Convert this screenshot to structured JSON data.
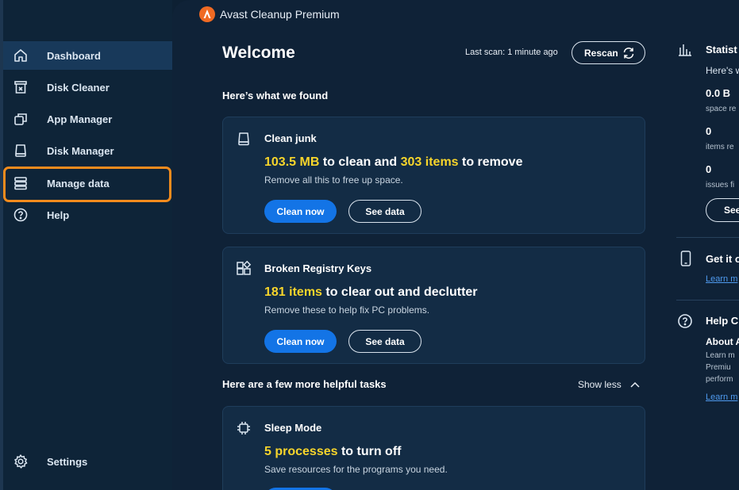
{
  "app": {
    "title": "Avast Cleanup Premium"
  },
  "sidebar": {
    "items": [
      {
        "label": "Dashboard",
        "icon": "home-icon"
      },
      {
        "label": "Disk Cleaner",
        "icon": "trash-icon"
      },
      {
        "label": "App Manager",
        "icon": "windows-icon"
      },
      {
        "label": "Disk Manager",
        "icon": "drive-icon"
      },
      {
        "label": "Manage data",
        "icon": "database-icon"
      },
      {
        "label": "Help",
        "icon": "help-icon"
      }
    ],
    "settings_label": "Settings"
  },
  "header": {
    "welcome": "Welcome",
    "last_scan": "Last scan: 1 minute ago",
    "rescan_label": "Rescan"
  },
  "found": {
    "section_title": "Here’s what we found",
    "cards": [
      {
        "title": "Clean junk",
        "highlight1": "103.5 MB",
        "text1": " to clean and ",
        "highlight2": "303 items",
        "text2": " to remove",
        "subtitle": "Remove all this to free up space.",
        "primary_label": "Clean now",
        "secondary_label": "See data"
      },
      {
        "title": "Broken Registry Keys",
        "highlight1": "181 items",
        "text1": " to clear out and declutter",
        "subtitle": "Remove these to help fix PC problems.",
        "primary_label": "Clean now",
        "secondary_label": "See data"
      }
    ]
  },
  "tasks": {
    "section_title": "Here are a few more helpful tasks",
    "show_less_label": "Show less",
    "cards": [
      {
        "title": "Sleep Mode",
        "highlight1": "5 processes",
        "text1": " to turn off",
        "subtitle": "Save resources for the programs you need."
      }
    ]
  },
  "right_panel": {
    "stats_title": "Statist",
    "stats_intro": "Here's w",
    "stat1_value": "0.0 B",
    "stat1_label": "space re",
    "stat2_value": "0",
    "stat2_label": "items re",
    "stat3_value": "0",
    "stat3_label": "issues fi",
    "stats_button": "See",
    "mobile_title": "Get it o",
    "mobile_link": "Learn m",
    "help_title": "Help C",
    "help_about": "About A",
    "help_line1": "Learn m",
    "help_line2": "Premiu",
    "help_line3": "perform",
    "help_link": "Learn m"
  },
  "colors": {
    "accent_yellow": "#f7d52b",
    "primary_blue": "#1374e6",
    "highlight_orange": "#f28b1d"
  }
}
